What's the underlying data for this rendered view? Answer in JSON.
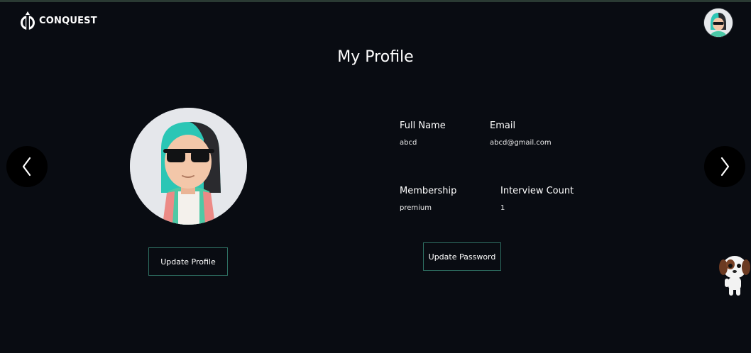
{
  "header": {
    "brand": "CONQUEST",
    "logo_icon": "conquest-logo-icon",
    "avatar_icon": "user-avatar-icon"
  },
  "page": {
    "title": "My Profile"
  },
  "profile": {
    "fields": [
      {
        "label": "Full Name",
        "value": "abcd"
      },
      {
        "label": "Email",
        "value": "abcd@gmail.com"
      },
      {
        "label": "Membership",
        "value": "premium"
      },
      {
        "label": "Interview Count",
        "value": "1"
      }
    ],
    "update_profile_label": "Update Profile",
    "update_password_label": "Update Password"
  },
  "nav": {
    "prev_icon": "chevron-left-icon",
    "next_icon": "chevron-right-icon"
  },
  "mascot": {
    "icon": "puppy-mascot-icon"
  },
  "colors": {
    "background": "#090c12",
    "button_border": "#2e6f62",
    "text": "#ffffff",
    "avatar_hair": "#2bc6b5"
  }
}
